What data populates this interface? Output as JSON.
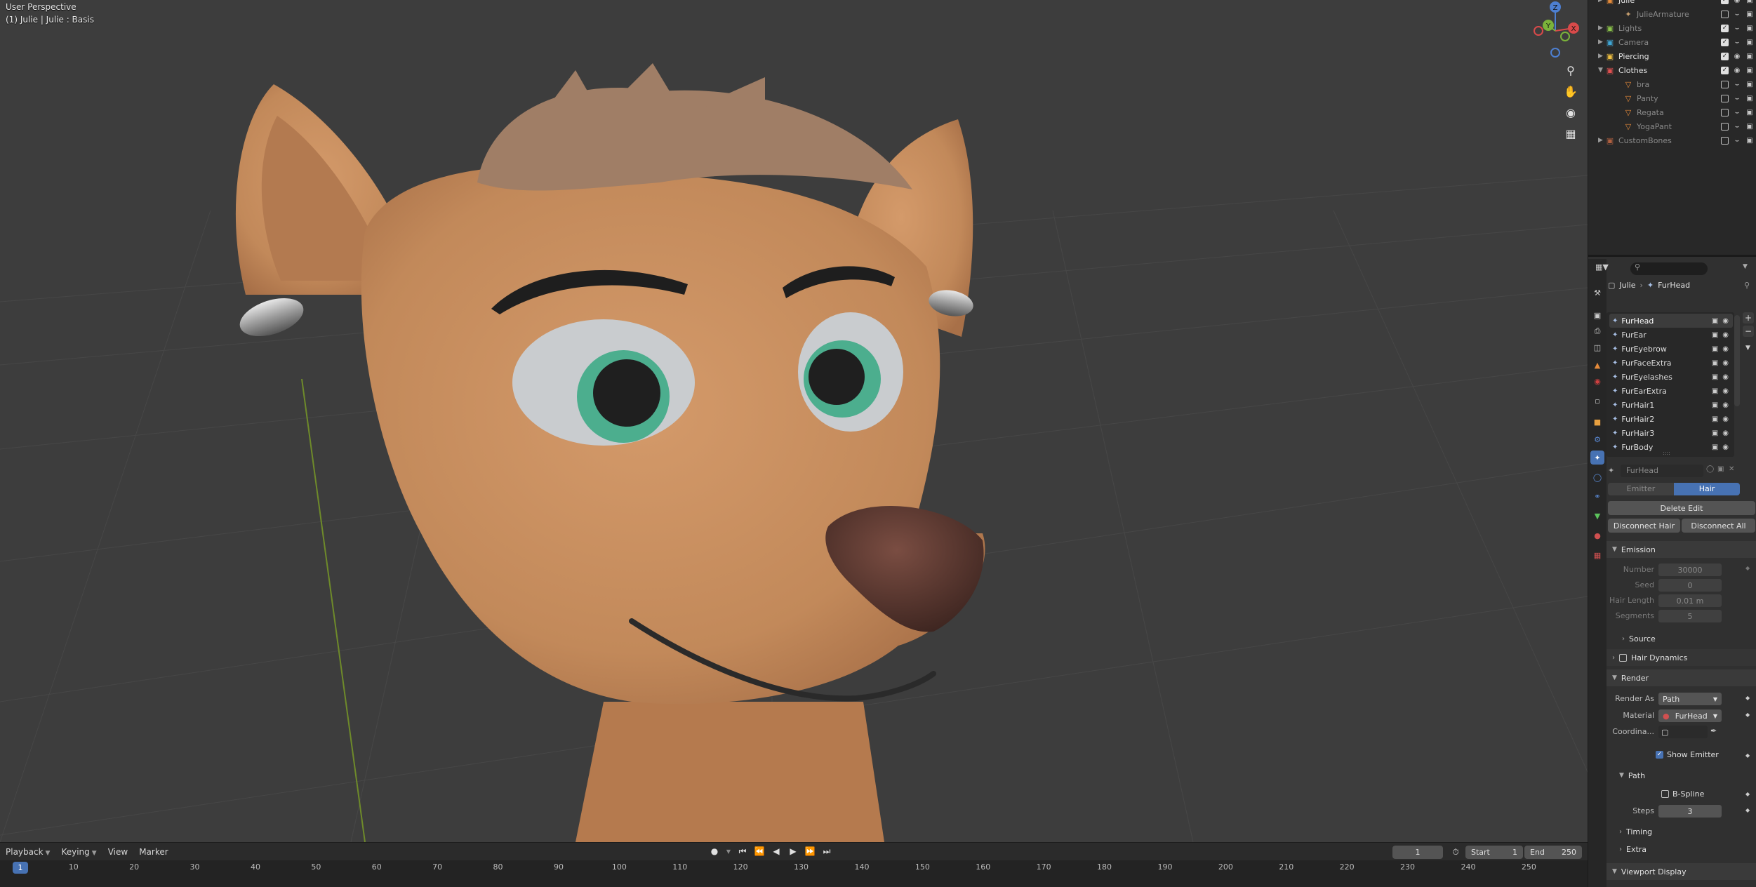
{
  "viewport": {
    "title": "User Perspective",
    "subtitle": "(1) Julie | Julie : Basis",
    "gizmo": {
      "x": "X",
      "y": "Y",
      "z": "Z"
    }
  },
  "timeline": {
    "menus": [
      "Playback",
      "Keying",
      "View",
      "Marker"
    ],
    "current_frame": "1",
    "start_label": "Start",
    "start_value": "1",
    "end_label": "End",
    "end_value": "250",
    "ticks": [
      "1",
      "10",
      "20",
      "30",
      "40",
      "50",
      "60",
      "70",
      "80",
      "90",
      "100",
      "110",
      "120",
      "130",
      "140",
      "150",
      "160",
      "170",
      "180",
      "190",
      "200",
      "210",
      "220",
      "230",
      "240",
      "250"
    ]
  },
  "outliner": {
    "rows": [
      {
        "name": "Julie",
        "icon": "collection-icon",
        "color": "#e58a3a",
        "indent": 1,
        "checkbox": true,
        "eye": true,
        "camera": true,
        "dim": false
      },
      {
        "name": "JulieArmature",
        "icon": "armature-icon",
        "color": "#c8a070",
        "indent": 2,
        "checkbox": false,
        "eye": false,
        "camera": true,
        "dim": true
      },
      {
        "name": "Lights",
        "icon": "collection-icon",
        "color": "#8bc34a",
        "indent": 1,
        "checkbox": true,
        "eye": false,
        "camera": true,
        "dim": true
      },
      {
        "name": "Camera",
        "icon": "collection-icon",
        "color": "#3fa7d6",
        "indent": 1,
        "checkbox": true,
        "eye": false,
        "camera": true,
        "dim": true
      },
      {
        "name": "Piercing",
        "icon": "collection-icon",
        "color": "#f0c040",
        "indent": 1,
        "checkbox": true,
        "eye": true,
        "camera": true,
        "dim": false
      },
      {
        "name": "Clothes",
        "icon": "collection-icon",
        "color": "#e05050",
        "indent": 1,
        "checkbox": true,
        "eye": true,
        "camera": true,
        "dim": false
      },
      {
        "name": "bra",
        "icon": "mesh-icon",
        "color": "#e58a3a",
        "indent": 2,
        "checkbox": false,
        "eye": false,
        "camera": true,
        "dim": true
      },
      {
        "name": "Panty",
        "icon": "mesh-icon",
        "color": "#e58a3a",
        "indent": 2,
        "checkbox": false,
        "eye": false,
        "camera": true,
        "dim": true
      },
      {
        "name": "Regata",
        "icon": "mesh-icon",
        "color": "#e58a3a",
        "indent": 2,
        "checkbox": false,
        "eye": false,
        "camera": true,
        "dim": true
      },
      {
        "name": "YogaPant",
        "icon": "mesh-icon",
        "color": "#e58a3a",
        "indent": 2,
        "checkbox": false,
        "eye": false,
        "camera": true,
        "dim": true
      },
      {
        "name": "CustomBones",
        "icon": "collection-icon",
        "color": "#b06040",
        "indent": 1,
        "checkbox": false,
        "eye": false,
        "camera": true,
        "dim": true
      }
    ]
  },
  "properties": {
    "breadcrumb": {
      "object": "Julie",
      "system": "FurHead"
    },
    "particle_systems": [
      "FurHead",
      "FurEar",
      "FurEyebrow",
      "FurFaceExtra",
      "FurEyelashes",
      "FurEarExtra",
      "FurHair1",
      "FurHair2",
      "FurHair3",
      "FurBody"
    ],
    "settings_name": "FurHead",
    "type_tabs": [
      "Emitter",
      "Hair"
    ],
    "delete_edit": "Delete Edit",
    "disconnect_hair": "Disconnect Hair",
    "disconnect_all": "Disconnect All",
    "emission": {
      "title": "Emission",
      "number_label": "Number",
      "number_value": "30000",
      "seed_label": "Seed",
      "seed_value": "0",
      "hair_length_label": "Hair Length",
      "hair_length_value": "0.01 m",
      "segments_label": "Segments",
      "segments_value": "5"
    },
    "source": "Source",
    "hair_dynamics": "Hair Dynamics",
    "render": {
      "title": "Render",
      "render_as_label": "Render As",
      "render_as_value": "Path",
      "material_label": "Material",
      "material_value": "FurHead",
      "coordinate_label": "Coordina...",
      "show_emitter": "Show Emitter"
    },
    "path": {
      "title": "Path",
      "bspline": "B-Spline",
      "steps_label": "Steps",
      "steps_value": "3"
    },
    "timing": "Timing",
    "extra": "Extra",
    "viewport_display": "Viewport Display"
  },
  "colors": {
    "accent": "#4772b3",
    "viewport_bg": "#3d3d3d",
    "fur": "#c58c5e",
    "iris": "#4cae8e",
    "nose": "#5a3a32"
  }
}
